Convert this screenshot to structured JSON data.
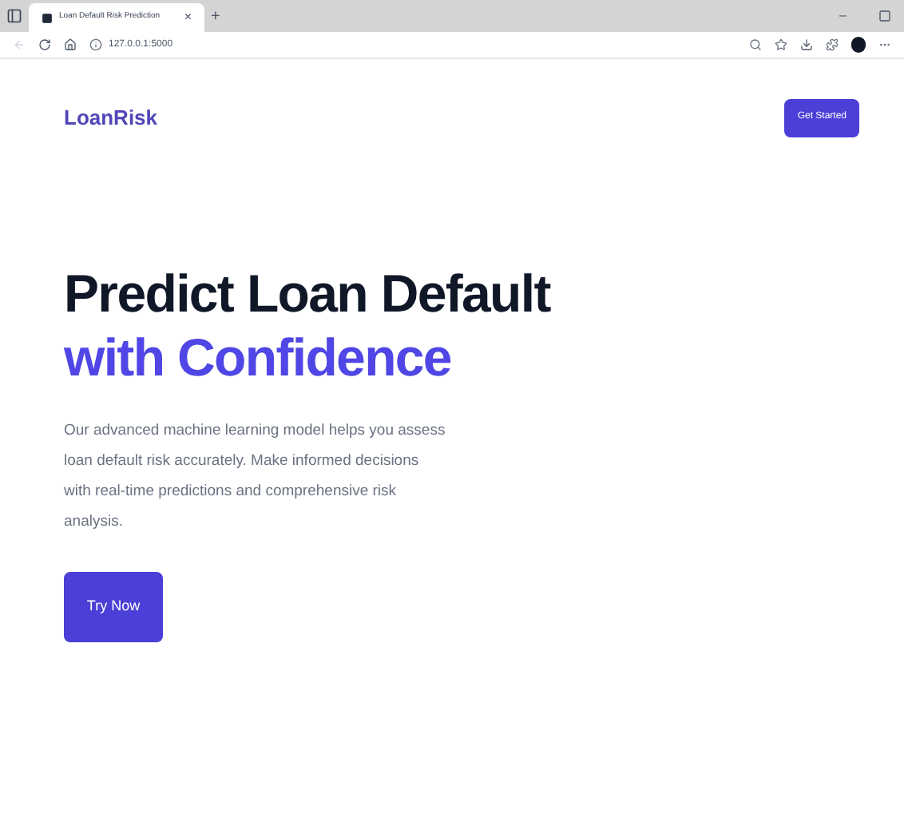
{
  "browser": {
    "tab_title": "Loan Default Risk Prediction",
    "tab_close": "×",
    "new_tab": "+",
    "url": "127.0.0.1:5000",
    "minimize": "–"
  },
  "nav": {
    "logo": "LoanRisk",
    "cta": "Get Started"
  },
  "hero": {
    "title_line_1": "Predict Loan Default",
    "title_line_2": "with Confidence",
    "description": "Our advanced machine learning model helps you assess loan default risk accurately. Make informed decisions with real-time predictions and comprehensive risk analysis.",
    "button": "Try Now"
  }
}
